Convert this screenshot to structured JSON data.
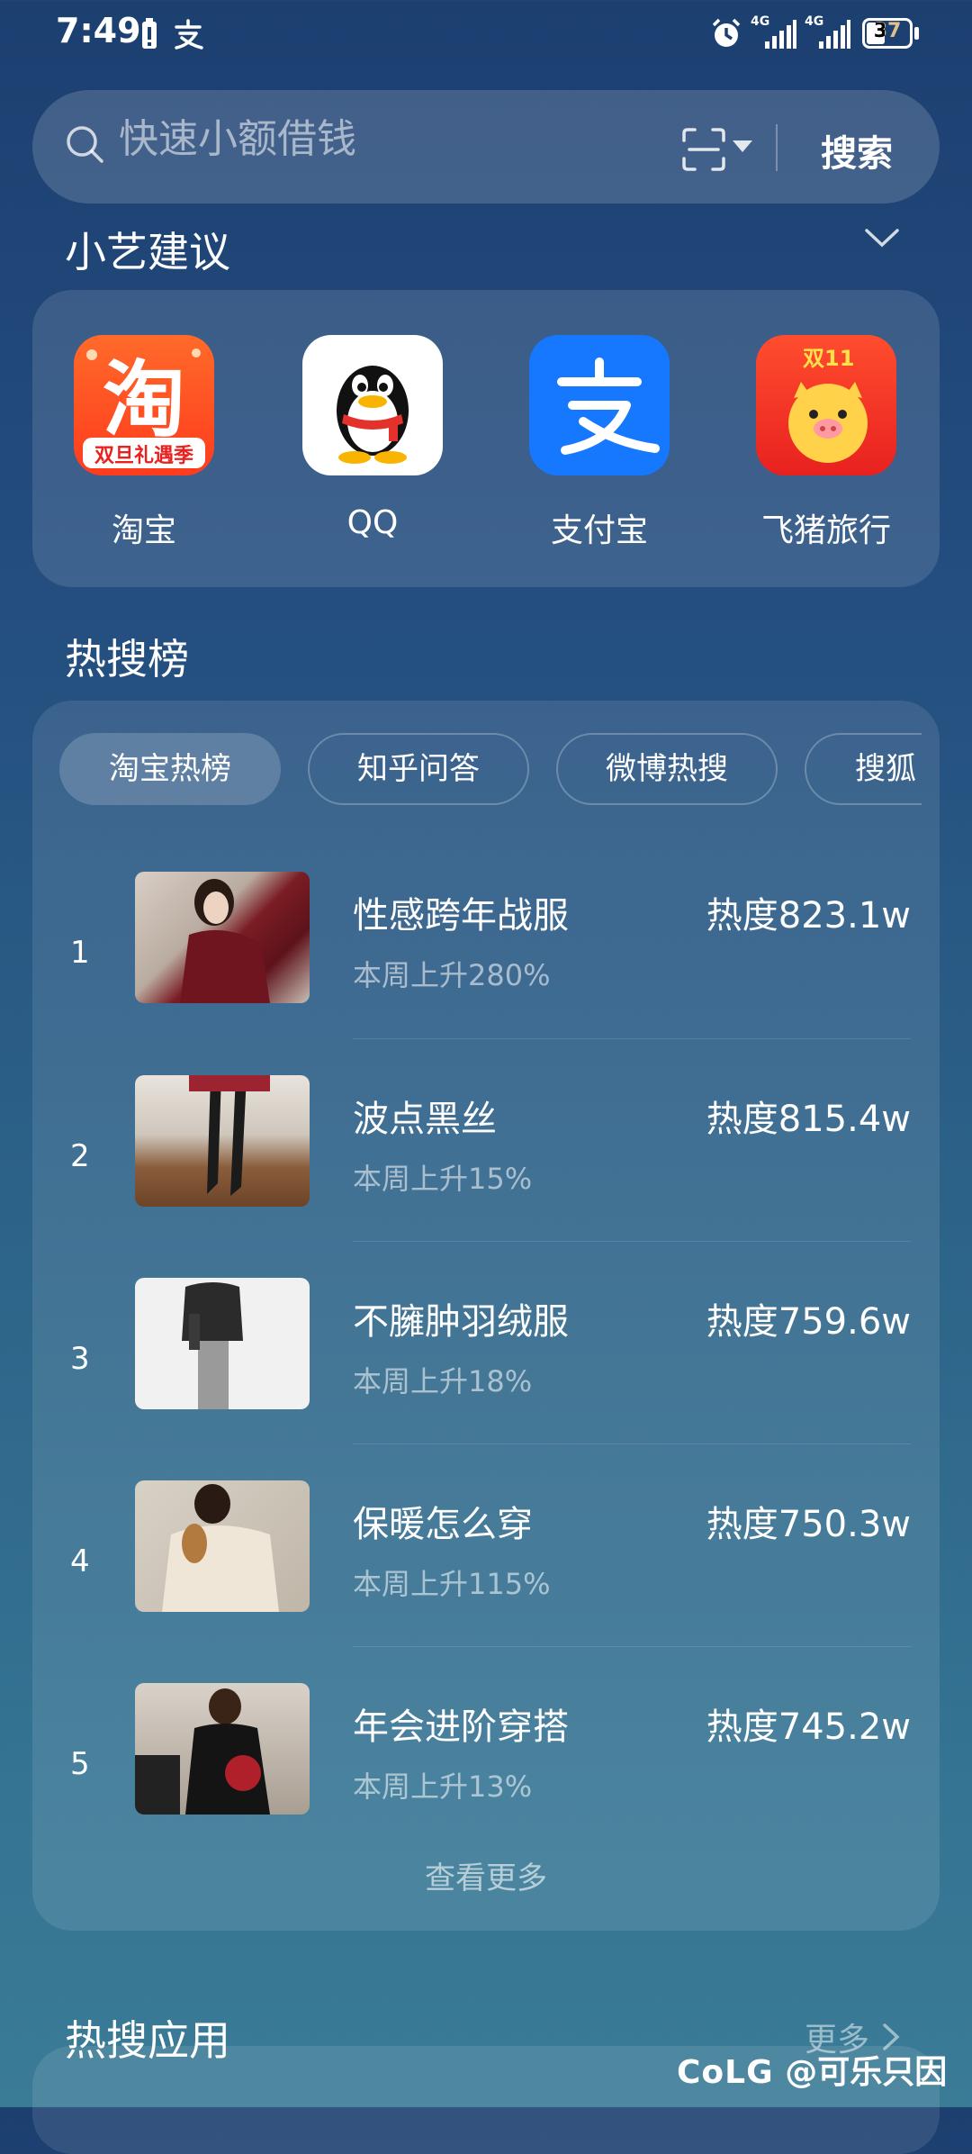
{
  "status": {
    "time": "7:49",
    "battery": "37",
    "net1": "4G",
    "net2": "4G"
  },
  "search": {
    "placeholder": "快速小额借钱",
    "button": "搜索"
  },
  "xiaoyi": {
    "title": "小艺建议"
  },
  "apps": [
    {
      "label": "淘宝",
      "icon": "taobao-icon"
    },
    {
      "label": "QQ",
      "icon": "qq-icon"
    },
    {
      "label": "支付宝",
      "icon": "alipay-icon"
    },
    {
      "label": "飞猪旅行",
      "icon": "fliggy-icon"
    }
  ],
  "taobao_badge": "双旦礼遇季",
  "fliggy_badge": "双11",
  "hot": {
    "title": "热搜榜",
    "tabs": [
      "淘宝热榜",
      "知乎问答",
      "微博热搜",
      "搜狐"
    ],
    "items": [
      {
        "rank": "1",
        "title": "性感跨年战服",
        "sub": "本周上升280%",
        "heat": "热度823.1w"
      },
      {
        "rank": "2",
        "title": "波点黑丝",
        "sub": "本周上升15%",
        "heat": "热度815.4w"
      },
      {
        "rank": "3",
        "title": "不臃肿羽绒服",
        "sub": "本周上升18%",
        "heat": "热度759.6w"
      },
      {
        "rank": "4",
        "title": "保暖怎么穿",
        "sub": "本周上升115%",
        "heat": "热度750.3w"
      },
      {
        "rank": "5",
        "title": "年会进阶穿搭",
        "sub": "本周上升13%",
        "heat": "热度745.2w"
      }
    ],
    "more": "查看更多"
  },
  "hot_apps": {
    "title": "热搜应用",
    "more": "更多"
  },
  "watermark": {
    "logo": "CoLG",
    "user": "@可乐只因"
  }
}
